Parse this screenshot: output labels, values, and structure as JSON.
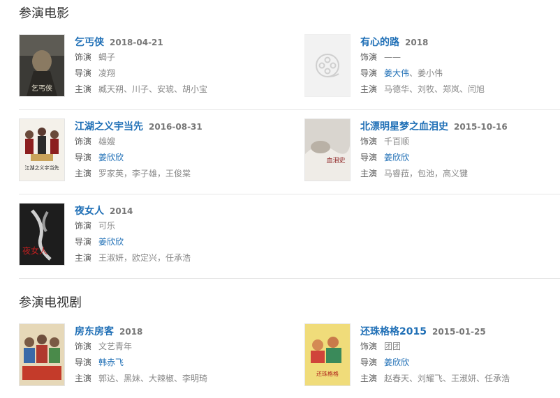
{
  "sections": {
    "movies_title": "参演电影",
    "tv_title": "参演电视剧"
  },
  "labels": {
    "role": "饰演",
    "director": "导演",
    "cast": "主演"
  },
  "movies": [
    {
      "title": "乞丐侠",
      "date": "2018-04-21",
      "role": "蝎子",
      "director": "凌翔",
      "cast": "臧天朔、川子、安琥、胡小宝"
    },
    {
      "title": "有心的路",
      "date": "2018",
      "role": "——",
      "director_a": "姜大伟",
      "director_sep": "、",
      "director_b": "姜小伟",
      "cast": "马德华、刘牧、郑岚、闫旭"
    },
    {
      "title": "江湖之义宇当先",
      "date": "2016-08-31",
      "role": "雄嫂",
      "director": "姜欣欣",
      "cast": "罗家英，李子雄，王俊棠"
    },
    {
      "title": "北漂明星梦之血泪史",
      "date": "2015-10-16",
      "role": "千百顺",
      "director": "姜欣欣",
      "cast": "马睿菈，包池，高义键"
    },
    {
      "title": "夜女人",
      "date": "2014",
      "role": "可乐",
      "director": "姜欣欣",
      "cast": "王淑妍，欧定兴，任承浩"
    }
  ],
  "tv": [
    {
      "title": "房东房客",
      "date": "2018",
      "role": "文艺青年",
      "director": "韩赤飞",
      "cast": "郭达、黑妹、大辣椒、李明琦"
    },
    {
      "title": "还珠格格2015",
      "date": "2015-01-25",
      "role": "团团",
      "director": "姜欣欣",
      "cast": "赵春天、刘耀飞、王淑妍、任承浩"
    }
  ],
  "poster_texts": {
    "p1": "乞丐侠",
    "p3": "江湖之义宇当先",
    "p4": "血泪史",
    "p5": "夜女人",
    "p7": "还珠格格"
  },
  "colors": {
    "link": "#1f6fb6",
    "divider": "#e6e6e6"
  }
}
